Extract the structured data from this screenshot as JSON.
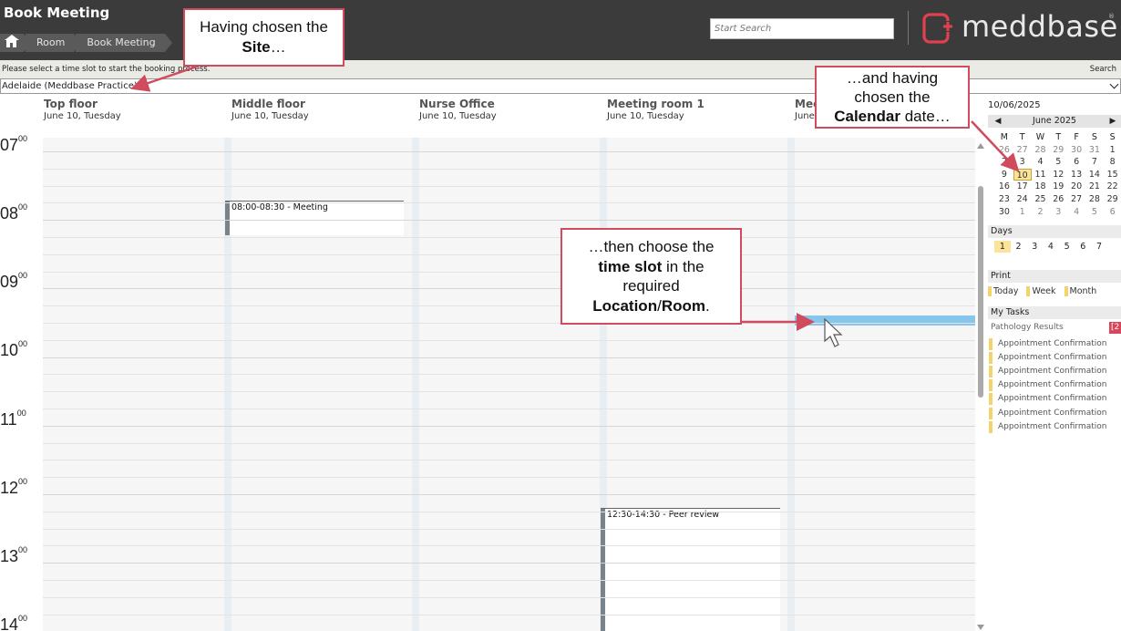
{
  "header": {
    "title": "Book Meeting",
    "breadcrumbs": [
      "Room",
      "Book Meeting"
    ],
    "search_placeholder": "Start Search",
    "logo_text": "meddbase",
    "logo_reg": "®"
  },
  "subbar": {
    "hint": "Please select a time slot to start the booking process.",
    "search_label": "Search",
    "site_value": "Adelaide (Meddbase Practice)"
  },
  "rooms": [
    {
      "name": "Top floor",
      "date": "June 10, Tuesday"
    },
    {
      "name": "Middle floor",
      "date": "June 10, Tuesday"
    },
    {
      "name": "Nurse Office",
      "date": "June 10, Tuesday"
    },
    {
      "name": "Meeting room 1",
      "date": "June 10, Tuesday"
    },
    {
      "name": "Mee",
      "date": "June"
    }
  ],
  "hours": [
    "07",
    "08",
    "09",
    "10",
    "11",
    "12",
    "13",
    "14"
  ],
  "hour_suffix": "00",
  "appointments": [
    {
      "label": "08:00-08:30 - Meeting",
      "room": 1
    },
    {
      "label": "12:30-14:30 - Peer review",
      "room": 3
    }
  ],
  "sidebar": {
    "date_value": "10/06/2025",
    "month_label": "June 2025",
    "prev": "◀",
    "next": "▶",
    "dow": [
      "M",
      "T",
      "W",
      "T",
      "F",
      "S",
      "S"
    ],
    "weeks": [
      [
        "26",
        "27",
        "28",
        "29",
        "30",
        "31",
        "1"
      ],
      [
        "2",
        "3",
        "4",
        "5",
        "6",
        "7",
        "8"
      ],
      [
        "9",
        "10",
        "11",
        "12",
        "13",
        "14",
        "15"
      ],
      [
        "16",
        "17",
        "18",
        "19",
        "20",
        "21",
        "22"
      ],
      [
        "23",
        "24",
        "25",
        "26",
        "27",
        "28",
        "29"
      ],
      [
        "30",
        "1",
        "2",
        "3",
        "4",
        "5",
        "6"
      ]
    ],
    "selected_day": "10",
    "days_label": "Days",
    "days": [
      "1",
      "2",
      "3",
      "4",
      "5",
      "6",
      "7"
    ],
    "print_label": "Print",
    "print_options": [
      "Today",
      "Week",
      "Month"
    ],
    "tasks_label": "My Tasks",
    "task_group": "Pathology Results",
    "task_count": "[2",
    "tasks": [
      "Appointment Confirmation",
      "Appointment Confirmation",
      "Appointment Confirmation",
      "Appointment Confirmation",
      "Appointment Confirmation",
      "Appointment Confirmation",
      "Appointment Confirmation"
    ]
  },
  "annotations": {
    "site": {
      "pre": "Having chosen the",
      "bold": "Site",
      "post": "…"
    },
    "calendar": {
      "line1": "…and having",
      "line2": "chosen the",
      "bold": "Calendar",
      "post": " date…"
    },
    "slot": {
      "line1": "…then choose the",
      "bold1": "time slot",
      "mid": " in the",
      "line3": "required",
      "bold2": "Location",
      "sep": "/",
      "bold3": "Room",
      "end": "."
    }
  },
  "colors": {
    "header_bg": "#3b3b3b",
    "accent": "#e0414f",
    "slot_highlight": "#87c6ea",
    "callout_border": "#cf4b5d"
  }
}
